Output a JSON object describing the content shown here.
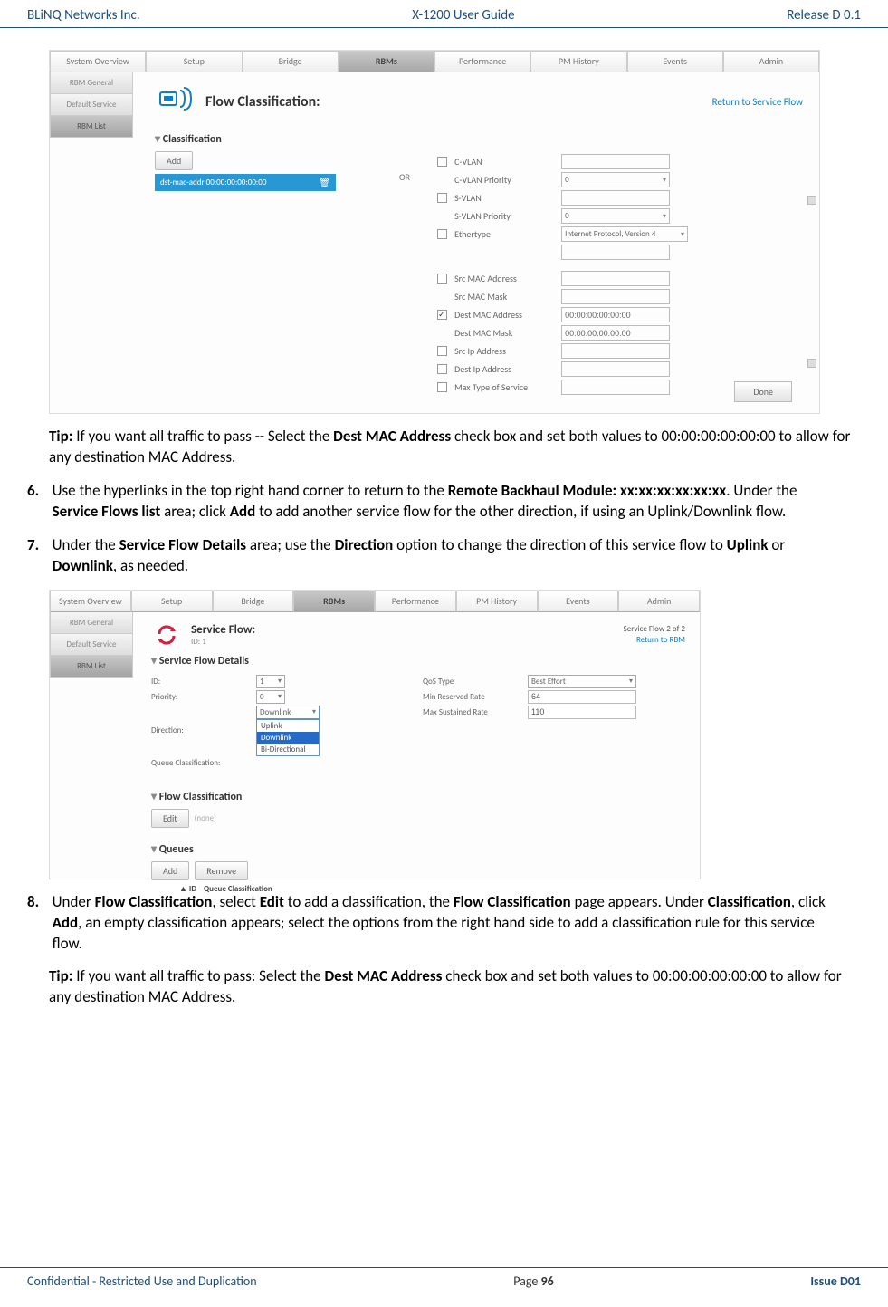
{
  "header": {
    "left": "BLiNQ Networks Inc.",
    "center": "X-1200 User Guide",
    "right": "Release D 0.1"
  },
  "shot1": {
    "tabs": [
      "System Overview",
      "Setup",
      "Bridge",
      "RBMs",
      "Performance",
      "PM History",
      "Events",
      "Admin"
    ],
    "tab_sel_index": 3,
    "side": [
      "RBM General",
      "Default Service",
      "RBM List"
    ],
    "side_sel_index": 2,
    "title": "Flow Classification:",
    "return_link": "Return to Service Flow",
    "section": "Classification",
    "add_btn": "Add",
    "selrule": "dst-mac-addr  00:00:00:00:00:00",
    "or": "OR",
    "fields": {
      "cvlan": "C-VLAN",
      "cvlanp": "C-VLAN Priority",
      "cvlanp_val": "0",
      "svlan": "S-VLAN",
      "svlanp": "S-VLAN Priority",
      "svlanp_val": "0",
      "eth": "Ethertype",
      "eth_val": "Internet Protocol, Version 4",
      "srcmac": "Src MAC Address",
      "srcmask": "Src MAC Mask",
      "dstmac": "Dest MAC Address",
      "dstmac_val": "00:00:00:00:00:00",
      "dstmask": "Dest MAC Mask",
      "dstmask_val": "00:00:00:00:00:00",
      "srcip": "Src Ip Address",
      "dstip": "Dest Ip Address",
      "maxtos": "Max Type of Service"
    },
    "done": "Done"
  },
  "tip1_a": "Tip:",
  "tip1_b": " If you want all traffic to pass -- Select the ",
  "tip1_c": "Dest MAC Address",
  "tip1_d": " check box and set both values to 00:00:00:00:00:00 to allow for any destination MAC Address.",
  "step6": {
    "n": "6.",
    "a": "Use the hyperlinks in the top right hand corner to return to the ",
    "b": "Remote Backhaul Module: xx:xx:xx:xx:xx:xx",
    "c": ". Under the ",
    "d": "Service Flows list",
    "e": " area; click ",
    "f": "Add",
    "g": " to add another service flow for the other direction, if using an Uplink/Downlink flow."
  },
  "step7": {
    "n": "7.",
    "a": "Under the ",
    "b": "Service Flow Details",
    "c": " area; use the ",
    "d": "Direction",
    "e": " option to change the direction of this service flow to ",
    "f": "Uplink",
    "g": " or ",
    "h": "Downlink",
    "i": ", as needed."
  },
  "shot2": {
    "tabs": [
      "System Overview",
      "Setup",
      "Bridge",
      "RBMs",
      "Performance",
      "PM History",
      "Events",
      "Admin"
    ],
    "side": [
      "RBM General",
      "Default Service",
      "RBM List"
    ],
    "title": "Service Flow:",
    "subid": "ID: 1",
    "top_r1": "Service Flow 2 of 2",
    "top_r2": "Return to RBM",
    "sect1": "Service Flow Details",
    "l_id": "ID:",
    "v_id": "1",
    "l_pri": "Priority:",
    "v_pri": "0",
    "l_dir": "Direction:",
    "dir_sel": "Downlink",
    "dir_opts": [
      "Uplink",
      "Downlink",
      "Bi-Directional"
    ],
    "l_qc": "Queue Classification:",
    "l_qos": "QoS Type",
    "v_qos": "Best Effort",
    "l_mrr": "Min Reserved Rate",
    "v_mrr": "64",
    "l_msr": "Max Sustained Rate",
    "v_msr": "110",
    "sect2": "Flow Classification",
    "editbtn": "Edit",
    "none": "(none)",
    "sect3": "Queues",
    "addbtn": "Add",
    "rembtn": "Remove",
    "qhd": "Queue Classification"
  },
  "step8": {
    "n": "8.",
    "a": "Under ",
    "b": "Flow Classification",
    "c": ", select ",
    "d": "Edit",
    "e": " to add a classification, the ",
    "f": "Flow Classification",
    "g": " page appears. Under ",
    "h": "Classification",
    "i": ", click ",
    "j": "Add",
    "k": ", an empty classification appears; select the options from the right hand side to add a classification rule for this service flow."
  },
  "tip2_a": "Tip:",
  "tip2_b": " If you want all traffic to pass: Select the ",
  "tip2_c": "Dest MAC Address",
  "tip2_d": " check box and set both values to 00:00:00:00:00:00 to allow for any destination MAC Address.",
  "footer": {
    "left": "Confidential - Restricted Use and Duplication",
    "mid_a": "Page ",
    "mid_b": "96",
    "right": "Issue D01"
  }
}
